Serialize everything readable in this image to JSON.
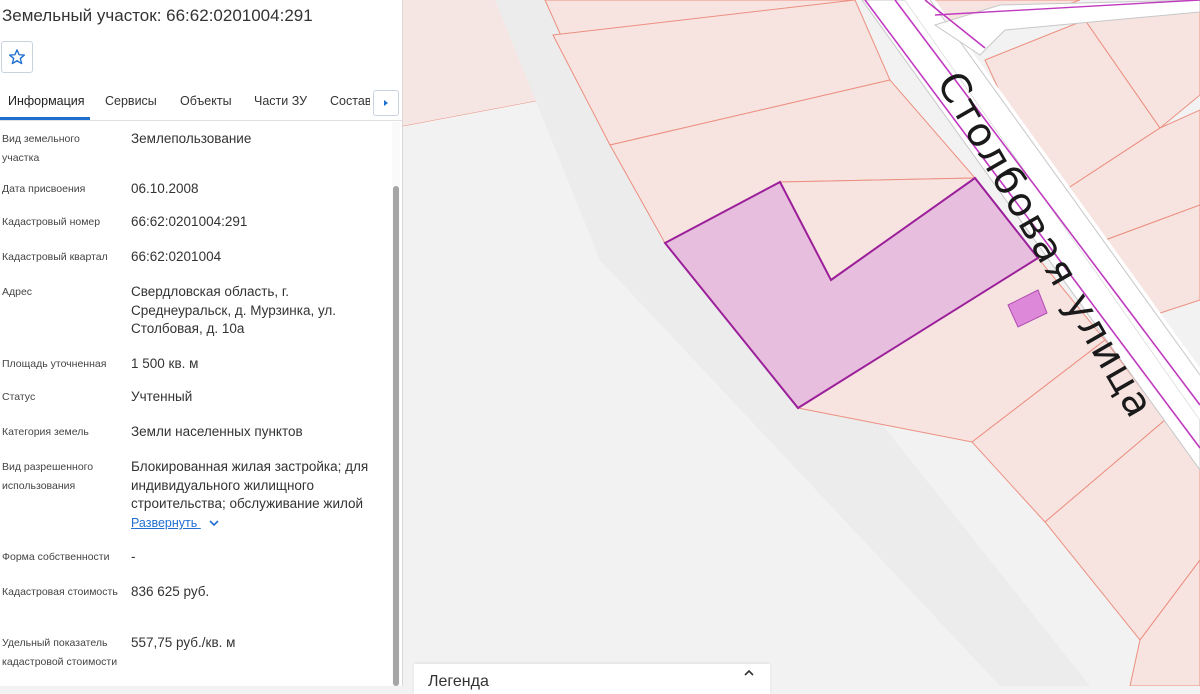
{
  "panel": {
    "title": "Земельный участок: 66:62:0201004:291",
    "tabs": [
      {
        "label": "Информация",
        "active": true
      },
      {
        "label": "Сервисы"
      },
      {
        "label": "Объекты"
      },
      {
        "label": "Части ЗУ"
      },
      {
        "label": "Состав"
      }
    ],
    "fields": [
      {
        "label": "Вид земельного участка",
        "value": "Землепользование"
      },
      {
        "label": "Дата присвоения",
        "value": "06.10.2008"
      },
      {
        "label": "Кадастровый номер",
        "value": "66:62:0201004:291"
      },
      {
        "label": "Кадастровый квартал",
        "value": "66:62:0201004"
      },
      {
        "label": "Адрес",
        "value": "Свердловская область, г. Среднеуральск, д. Мурзинка, ул. Столбовая, д. 10а"
      },
      {
        "label": "Площадь уточненная",
        "value": "1 500 кв. м"
      },
      {
        "label": "Статус",
        "value": "Учтенный"
      },
      {
        "label": "Категория земель",
        "value": "Земли населенных пунктов"
      },
      {
        "label": "Вид разрешенного использования",
        "value": "Блокированная жилая застройка; для индивидуального жилищного строительства; обслуживание жилой",
        "expand_label": "Развернуть"
      },
      {
        "label": "Форма собственности",
        "value": "-"
      },
      {
        "label": "Кадастровая стоимость",
        "value": "836 625 руб."
      },
      {
        "label": "Удельный показатель кадастровой стоимости",
        "value": "557,75 руб./кв. м"
      }
    ]
  },
  "map": {
    "street_name": "Столбовая улица",
    "colors": {
      "background": "#f2f2f2",
      "parcel_fill": "#f7e4e1",
      "parcel_stroke": "#ec8f80",
      "selected_fill": "#e7bedd",
      "selected_stroke": "#9b1f9a",
      "building_fill": "#de88d9",
      "road_fill": "#ffffff",
      "road_edge": "#c7c7c7"
    }
  },
  "legend": {
    "title": "Легенда"
  },
  "icons": {
    "favorite": "star-outline-icon",
    "tabs_next": "caret-right-icon",
    "expand": "chevron-down-icon",
    "legend_toggle": "chevron-up-icon"
  }
}
